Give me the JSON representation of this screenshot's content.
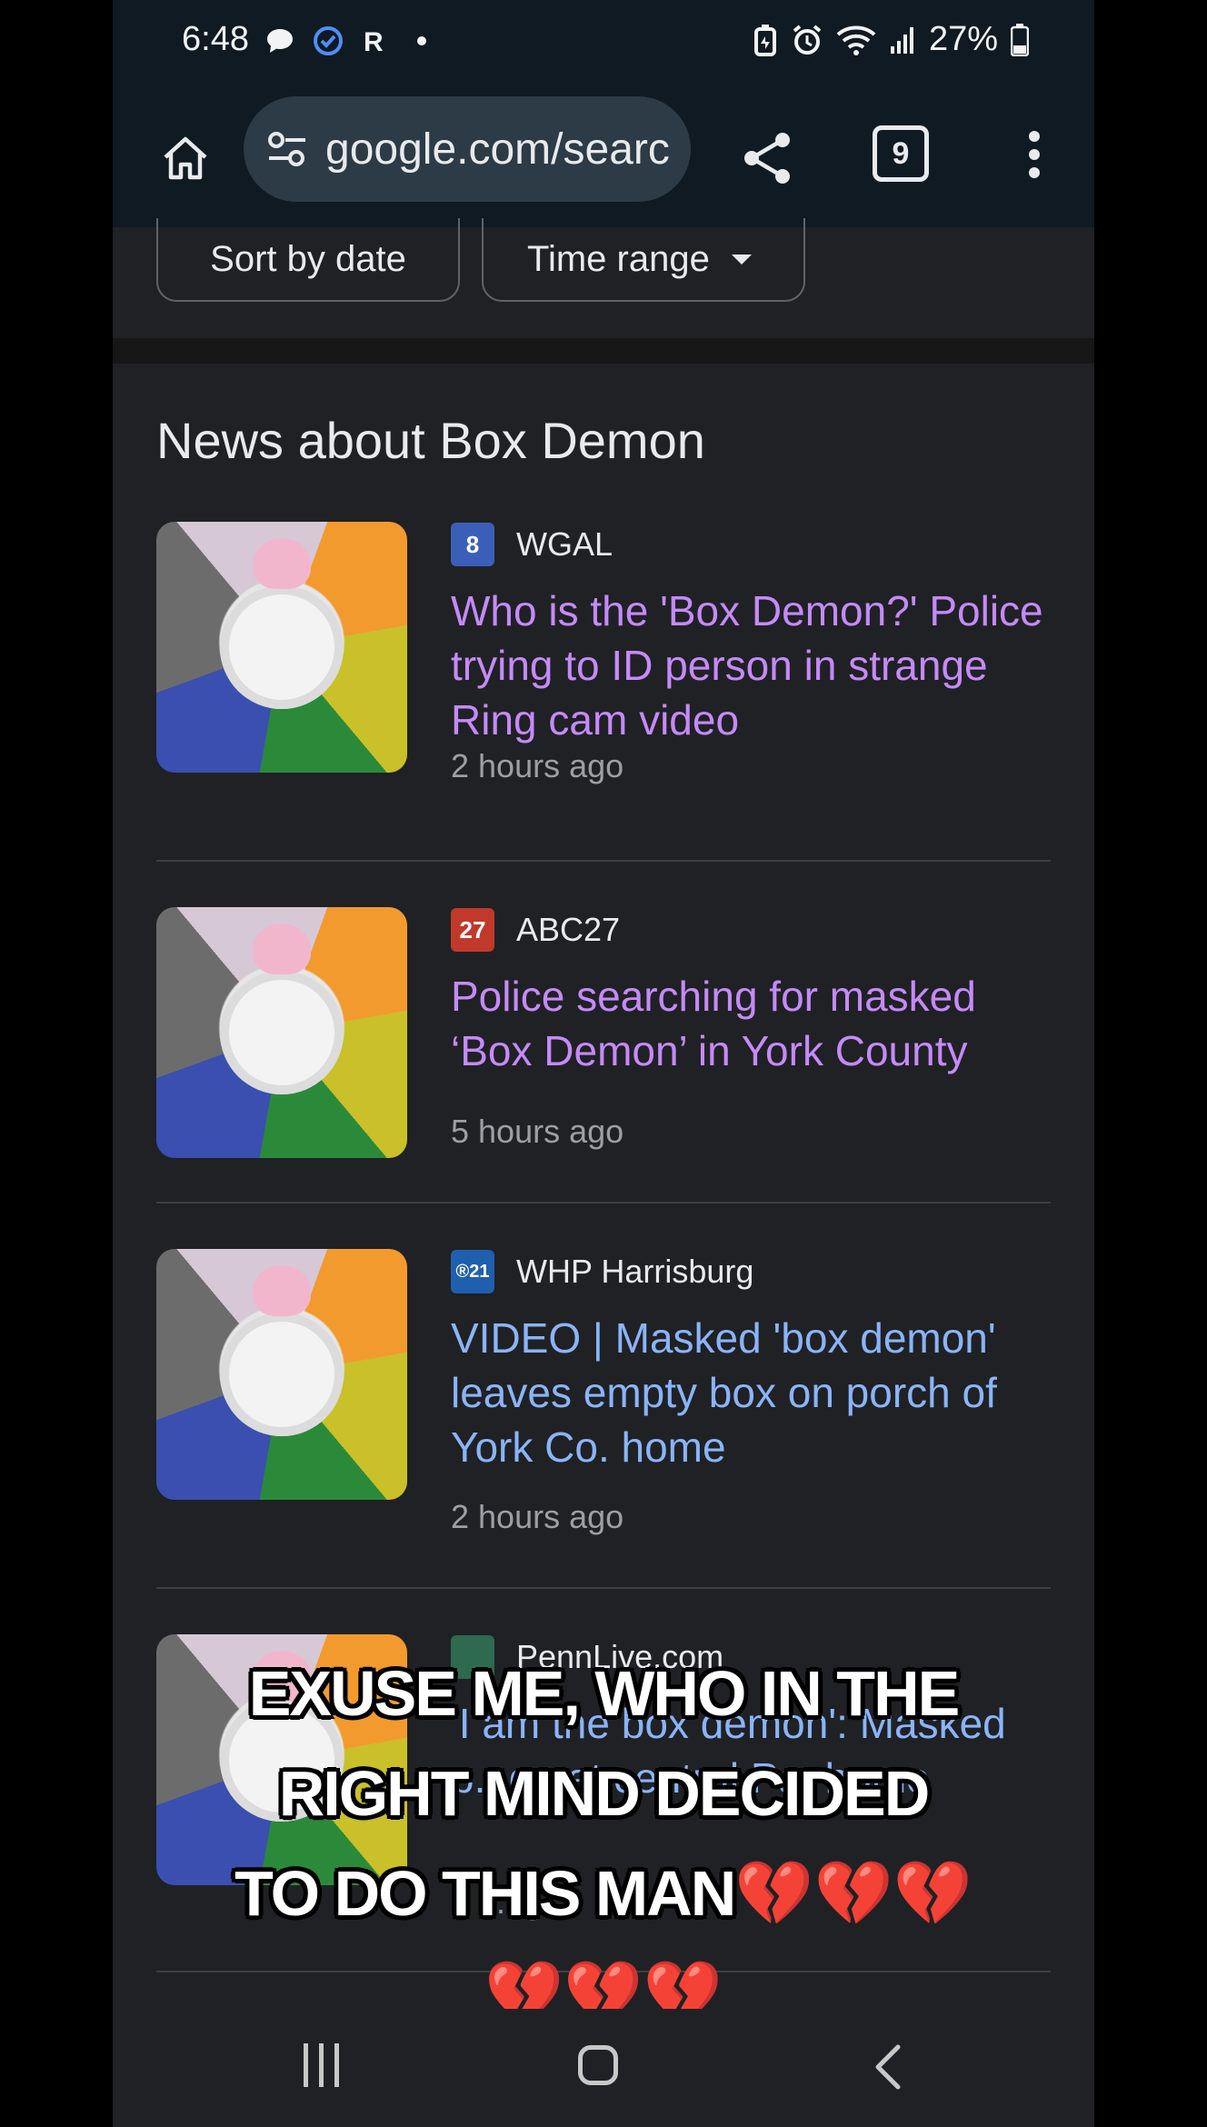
{
  "status_bar": {
    "time": "6:48",
    "battery": "27%",
    "left_icons": [
      "chat-bubble-icon",
      "check-badge-icon",
      "r-app-icon",
      "dot-icon"
    ],
    "right_icons": [
      "battery-saver-icon",
      "alarm-icon",
      "wifi-icon",
      "signal-icon",
      "battery-icon"
    ]
  },
  "toolbar": {
    "url": "google.com/searc",
    "tab_count": "9"
  },
  "filters": {
    "sort_label": "Sort by date",
    "time_label": "Time range"
  },
  "news": {
    "heading": "News about Box Demon",
    "articles": [
      {
        "source": "WGAL",
        "logo_text": "8",
        "logo_color": "#3b5fb8",
        "title": "Who is the 'Box Demon?' Police trying to ID person in strange Ring cam video",
        "time": "2 hours ago",
        "visited": true
      },
      {
        "source": "ABC27",
        "logo_text": "27",
        "logo_color": "#c0392b",
        "title": "Police searching for masked ‘Box Demon’ in York County",
        "time": "5 hours ago",
        "visited": true
      },
      {
        "source": "WHP Harrisburg",
        "logo_text": "®21",
        "logo_color": "#1f5fae",
        "title": "VIDEO | Masked 'box demon' leaves empty box on porch of York Co. home",
        "time": "2 hours ago",
        "visited": false
      },
      {
        "source": "PennLive.com",
        "logo_text": "",
        "logo_color": "#2d6a4f",
        "title": "'I am the box demon': Masked p...ge at central Pa. home",
        "time": "3 h...g",
        "visited": false
      }
    ]
  },
  "caption": {
    "line1": "EXUSE ME, WHO IN THE",
    "line2": "RIGHT MIND DECIDED",
    "line3": "TO DO THIS MAN",
    "hearts_line3": "💔💔💔",
    "hearts_line4": "💔💔💔"
  },
  "nav_bar": {
    "icons": [
      "recent-apps-icon",
      "home-icon",
      "back-icon"
    ]
  }
}
